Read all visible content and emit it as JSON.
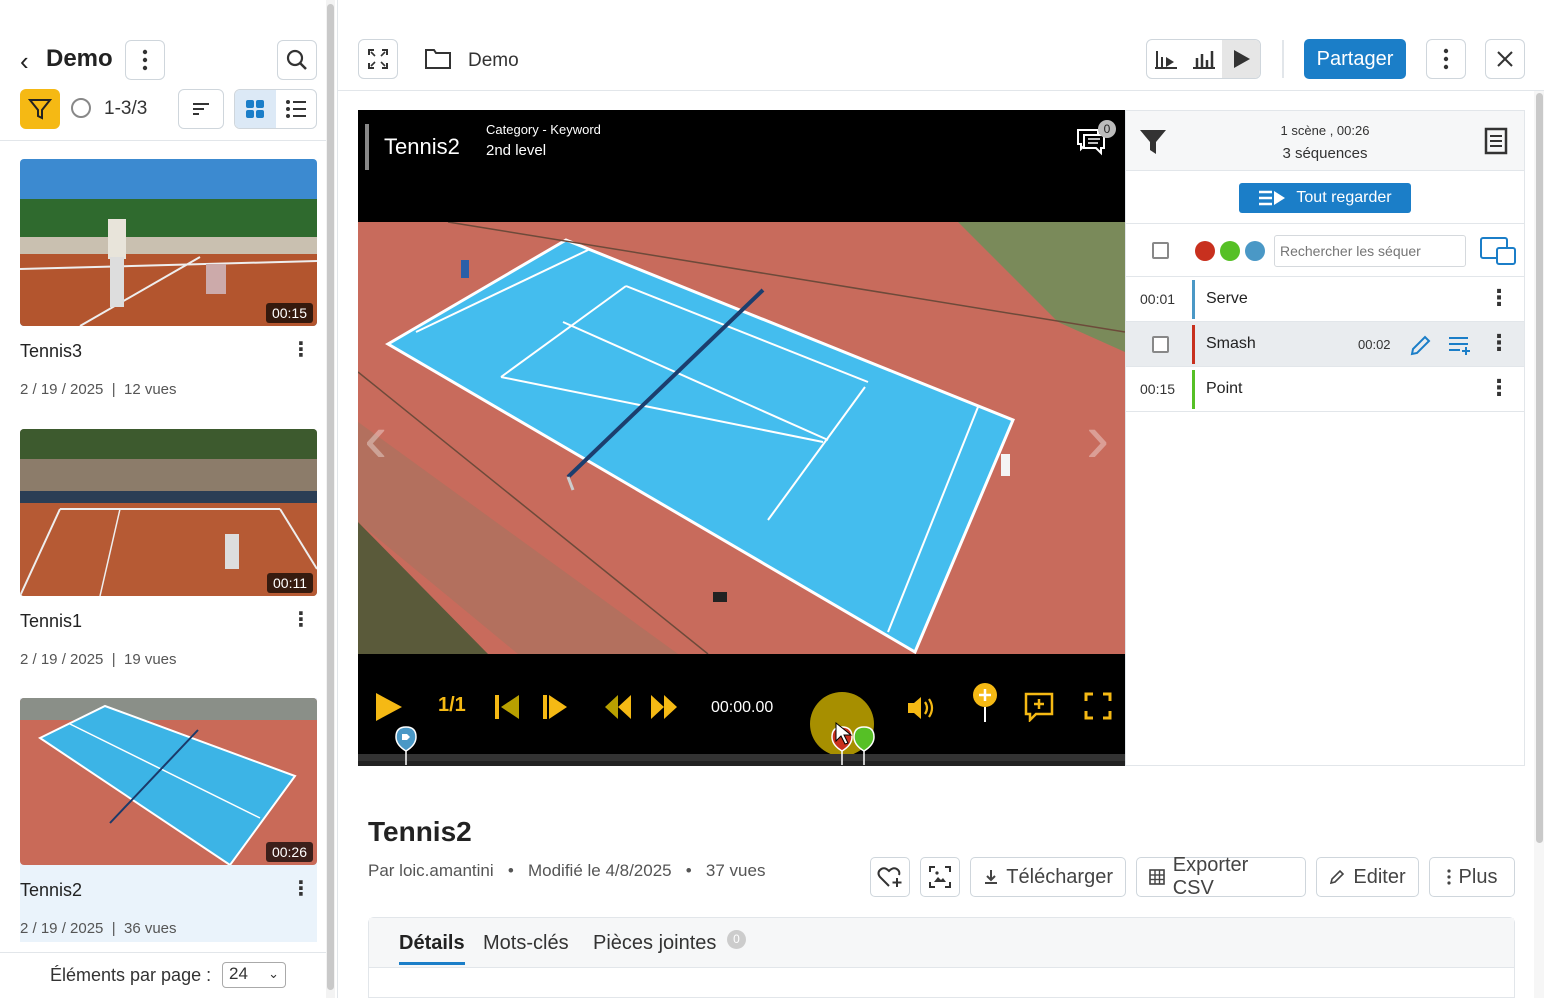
{
  "left": {
    "back_arrow": "‹",
    "title": "Demo",
    "count": "1-3/3",
    "cards": [
      {
        "title": "Tennis3",
        "duration": "00:15",
        "date": "2 / 19 / 2025",
        "views": "12 vues"
      },
      {
        "title": "Tennis1",
        "duration": "00:11",
        "date": "2 / 19 / 2025",
        "views": "19 vues"
      },
      {
        "title": "Tennis2",
        "duration": "00:26",
        "date": "2 / 19 / 2025",
        "views": "36 vues"
      }
    ],
    "per_page_label": "Éléments par page :",
    "per_page_value": "24"
  },
  "topbar": {
    "folder": "Demo",
    "share_label": "Partager"
  },
  "video": {
    "title": "Tennis2",
    "category": "Category - Keyword",
    "level": "2nd level",
    "comments_count": "0",
    "speed": "1/1",
    "time": "00:00.00"
  },
  "sequences": {
    "summary1": "1 scène , 00:26",
    "summary2": "3 séquences",
    "watch_all": "Tout regarder",
    "search_placeholder": "Rechercher les séquer",
    "colors": [
      "#c8301e",
      "#56c026",
      "#4a98c6"
    ],
    "rows": [
      {
        "time": "00:01",
        "name": "Serve",
        "color": "#4a98c6"
      },
      {
        "time": "",
        "name": "Smash",
        "duration": "00:02",
        "color": "#c8301e"
      },
      {
        "time": "00:15",
        "name": "Point",
        "color": "#56c026"
      }
    ]
  },
  "details": {
    "title": "Tennis2",
    "author": "Par loic.amantini",
    "modified": "Modifié le 4/8/2025",
    "views": "37 vues",
    "download": "Télécharger",
    "export": "Exporter CSV",
    "edit": "Editer",
    "more": "Plus",
    "tabs": [
      "Détails",
      "Mots-clés",
      "Pièces jointes"
    ],
    "attachments_count": "0"
  }
}
